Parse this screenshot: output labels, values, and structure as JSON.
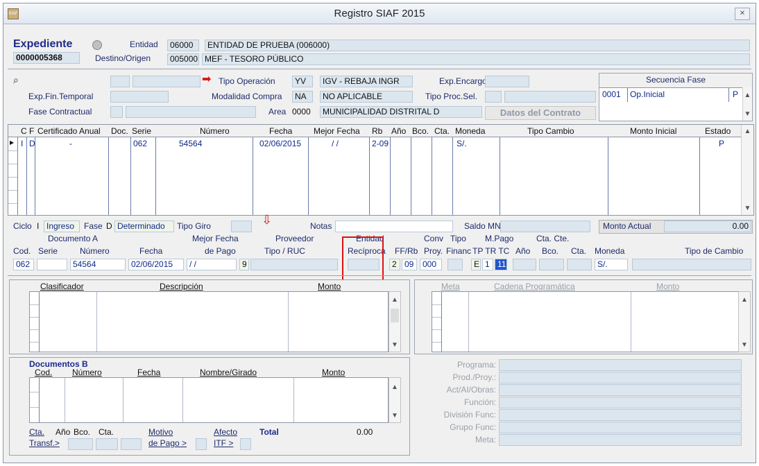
{
  "window": {
    "title": "Registro SIAF 2015",
    "icon_label": "SIAF"
  },
  "expediente": {
    "label": "Expediente",
    "number": "0000005368",
    "entidad_label": "Entidad",
    "entidad_code": "06000",
    "entidad_name": "ENTIDAD DE PRUEBA (006000)",
    "destino_label": "Destino/Origen",
    "destino_code": "005000",
    "destino_name": "MEF - TESORO PÚBLICO"
  },
  "operacion": {
    "tipo_label": "Tipo Operación",
    "tipo_code": "YV",
    "tipo_name": "IGV - REBAJA INGR",
    "exp_encargo_label": "Exp.Encargo",
    "exp_fin_label": "Exp.Fin.Temporal",
    "modalidad_label": "Modalidad Compra",
    "modalidad_code": "NA",
    "modalidad_name": "NO APLICABLE",
    "tipo_proc_label": "Tipo Proc.Sel.",
    "fase_contractual_label": "Fase Contractual",
    "area_label": "Area",
    "area_code": "0000",
    "area_name": "MUNICIPALIDAD DISTRITAL D",
    "datos_contrato_label": "Datos del Contrato"
  },
  "secuencia": {
    "title": "Secuencia Fase",
    "rows": [
      {
        "code": "0001",
        "name": "Op.Inicial",
        "state": "P"
      }
    ]
  },
  "main_grid": {
    "headers": [
      "C",
      "F",
      "Certificado Anual",
      "Doc.",
      "Serie",
      "Número",
      "Fecha",
      "Mejor Fecha",
      "Rb",
      "Año",
      "Bco.",
      "Cta.",
      "Moneda",
      "Tipo Cambio",
      "Monto Inicial",
      "Estado"
    ],
    "row": {
      "c": "I",
      "f": "D",
      "cert": "-",
      "doc": "062",
      "serie": "",
      "numero": "54564",
      "fecha": "02/06/2015",
      "mejor_fecha": "/ /",
      "rb": "2-09",
      "moneda": "S/.",
      "estado": "P"
    }
  },
  "status": {
    "ciclo_label": "Ciclo",
    "ciclo_code": "I",
    "ciclo_name": "Ingreso",
    "fase_label": "Fase",
    "fase_code": "D",
    "fase_name": "Determinado",
    "tipo_giro_label": "Tipo Giro",
    "notas_label": "Notas",
    "saldo_label": "Saldo MN",
    "monto_actual_label": "Monto Actual",
    "monto_actual": "0.00"
  },
  "docA": {
    "group_label": "Documento A",
    "cod_label": "Cod.",
    "serie_label": "Serie",
    "numero_label": "Número",
    "fecha_label": "Fecha",
    "mejor_fecha_label1": "Mejor Fecha",
    "mejor_fecha_label2": "de Pago",
    "proveedor_label": "Proveedor",
    "tipo_ruc_label": "Tipo / RUC",
    "entidad_label": "Entidad",
    "reciproca_label": "Recíproca",
    "ffrb_label": "FF/Rb",
    "conv_label": "Conv",
    "proy_label": "Proy.",
    "tipo_label": "Tipo",
    "financ_label": "Financ",
    "mpago_label": "M.Pago",
    "tp_tr_tc_label": "TP TR TC",
    "ctacte_label": "Cta. Cte.",
    "anio_label": "Año",
    "bco_label": "Bco.",
    "cta_label": "Cta.",
    "moneda_label": "Moneda",
    "tipo_cambio_label": "Tipo de Cambio",
    "cod": "062",
    "numero": "54564",
    "fecha": "02/06/2015",
    "mejor_fecha": "/ /",
    "tipo": "9",
    "ff": "2",
    "rb": "09",
    "proy": "000",
    "tp": "E",
    "tr": "1",
    "tc": "11",
    "moneda": "S/."
  },
  "clasificador": {
    "headers": [
      "Clasificador",
      "Descripción",
      "Monto"
    ]
  },
  "meta": {
    "headers": [
      "Meta",
      "Cadena Programática",
      "Monto"
    ]
  },
  "docB": {
    "title": "Documentos B",
    "headers": [
      "Cod.",
      "Número",
      "Fecha",
      "Nombre/Girado",
      "Monto"
    ],
    "cta_label1": "Cta.",
    "cta_label2": "Transf.>",
    "anio_label": "Año",
    "bco_label": "Bco.",
    "cta2_label": "Cta.",
    "motivo_label1": "Motivo",
    "motivo_label2": "de Pago >",
    "afecto_label1": "Afecto",
    "afecto_label2": "ITF >",
    "total_label": "Total",
    "total": "0.00"
  },
  "programa": {
    "labels": [
      "Programa:",
      "Prod./Proy.:",
      "Act/AI/Obras:",
      "Función:",
      "División Func:",
      "Grupo Func:",
      "Meta:"
    ]
  }
}
